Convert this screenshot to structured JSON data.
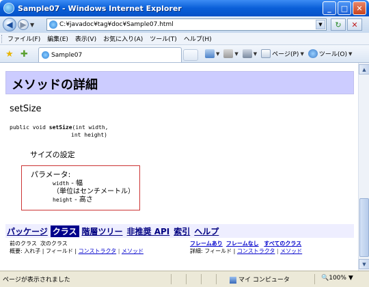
{
  "window": {
    "title": "Sample07 - Windows Internet Explorer",
    "buttons": {
      "minimize": "_",
      "maximize": "□",
      "close": "✕"
    }
  },
  "address": {
    "url": "C:¥javadoc¥tag¥doc¥Sample07.html",
    "back": "◀",
    "forward": "▶",
    "refresh": "↻",
    "stop": "✕"
  },
  "menu": {
    "items": [
      "ファイル(F)",
      "編集(E)",
      "表示(V)",
      "お気に入り(A)",
      "ツール(T)",
      "ヘルプ(H)"
    ]
  },
  "tabs": {
    "active_label": "Sample07"
  },
  "toolbar": {
    "page_label": "ページ(P)",
    "tools_label": "ツール(O)"
  },
  "content": {
    "section_header": "メソッドの詳細",
    "method_name": "setSize",
    "signature_prefix": "public void ",
    "signature_name": "setSize",
    "signature_line1_rest": "(int width,",
    "signature_line2": "int height)",
    "description": "サイズの設定",
    "param_label": "パラメータ:",
    "param1_name": "width",
    "param1_desc": " - 幅",
    "param1_note": "（単位はセンチメートル）",
    "param2_name": "height",
    "param2_desc": " - 高さ"
  },
  "navbar": {
    "items": [
      {
        "label": "パッケージ",
        "current": false
      },
      {
        "label": "クラス",
        "current": true
      },
      {
        "label": "階層ツリー",
        "current": false
      },
      {
        "label": "非推奨 API",
        "current": false
      },
      {
        "label": "索引",
        "current": false
      },
      {
        "label": "ヘルプ",
        "current": false
      }
    ],
    "prev_class": "前のクラス",
    "next_class": "次のクラス",
    "summary_prefix": "概要: 入れ子 | フィールド | ",
    "summary_ctor": "コンストラクタ",
    "summary_sep": " | ",
    "summary_method": "メソッド",
    "frames": "フレームあり",
    "noframes": "フレームなし",
    "allclasses": "すべてのクラス",
    "detail_prefix": "詳細: フィールド | ",
    "detail_ctor": "コンストラクタ",
    "detail_sep": " | ",
    "detail_method": "メソッド"
  },
  "status": {
    "text": "ページが表示されました",
    "zone": "マイ コンピュータ",
    "zoom": "100%"
  }
}
